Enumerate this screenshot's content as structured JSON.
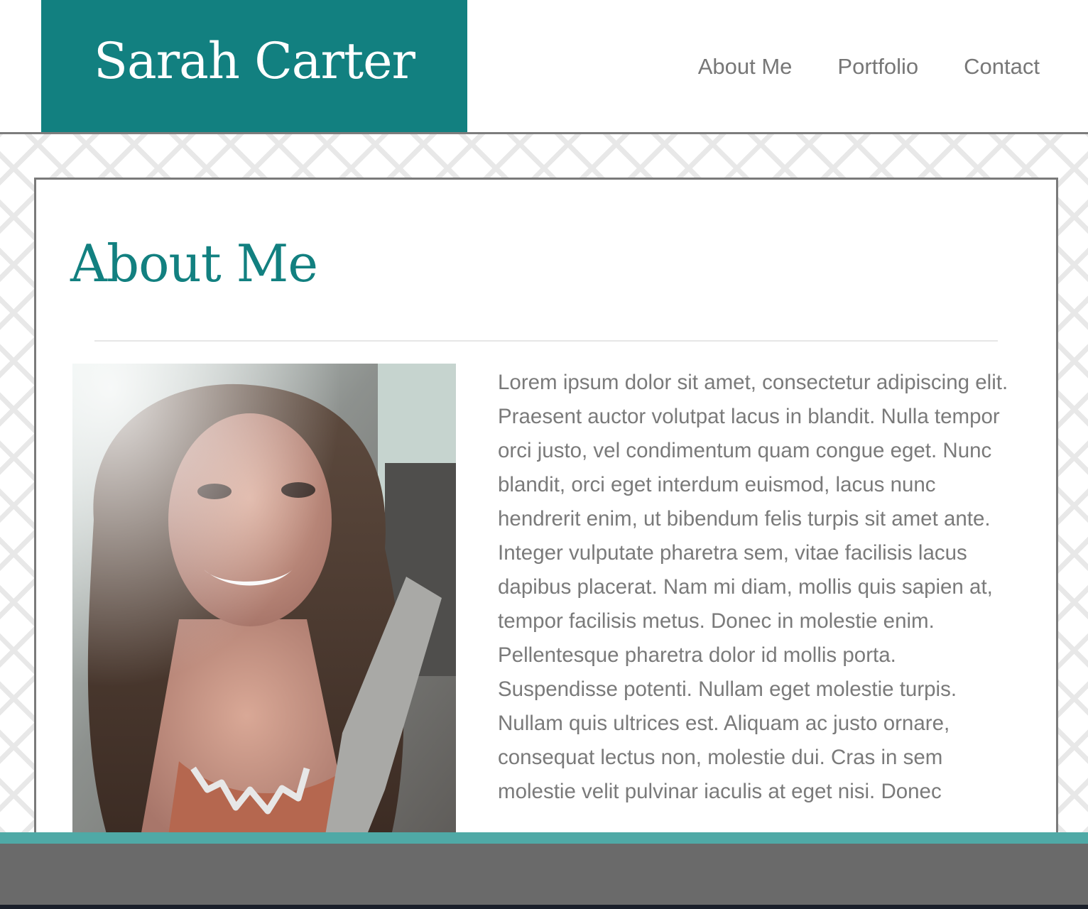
{
  "site": {
    "title": "Sarah Carter"
  },
  "nav": {
    "items": [
      "About Me",
      "Portfolio",
      "Contact"
    ]
  },
  "about": {
    "heading": "About Me",
    "body": "Lorem ipsum dolor sit amet, consectetur adipiscing elit. Praesent auctor volutpat lacus in blandit. Nulla tempor orci justo, vel condimentum quam congue eget. Nunc blandit, orci eget interdum euismod, lacus nunc hendrerit enim, ut bibendum felis turpis sit amet ante. Integer vulputate pharetra sem, vitae facilisis lacus dapibus placerat. Nam mi diam, mollis quis sapien at, tempor facilisis metus. Donec in molestie enim. Pellentesque pharetra dolor id mollis porta. Suspendisse potenti. Nullam eget molestie turpis. Nullam quis ultrices est. Aliquam ac justo ornare, consequat lectus non, molestie dui. Cras in sem molestie velit pulvinar iaculis at eget nisi. Donec"
  },
  "colors": {
    "brand": "#128080",
    "text_gray": "#777777",
    "border": "#7a7a7a",
    "footer_accent": "#4fa9a6",
    "footer": "#6a6a6a"
  }
}
